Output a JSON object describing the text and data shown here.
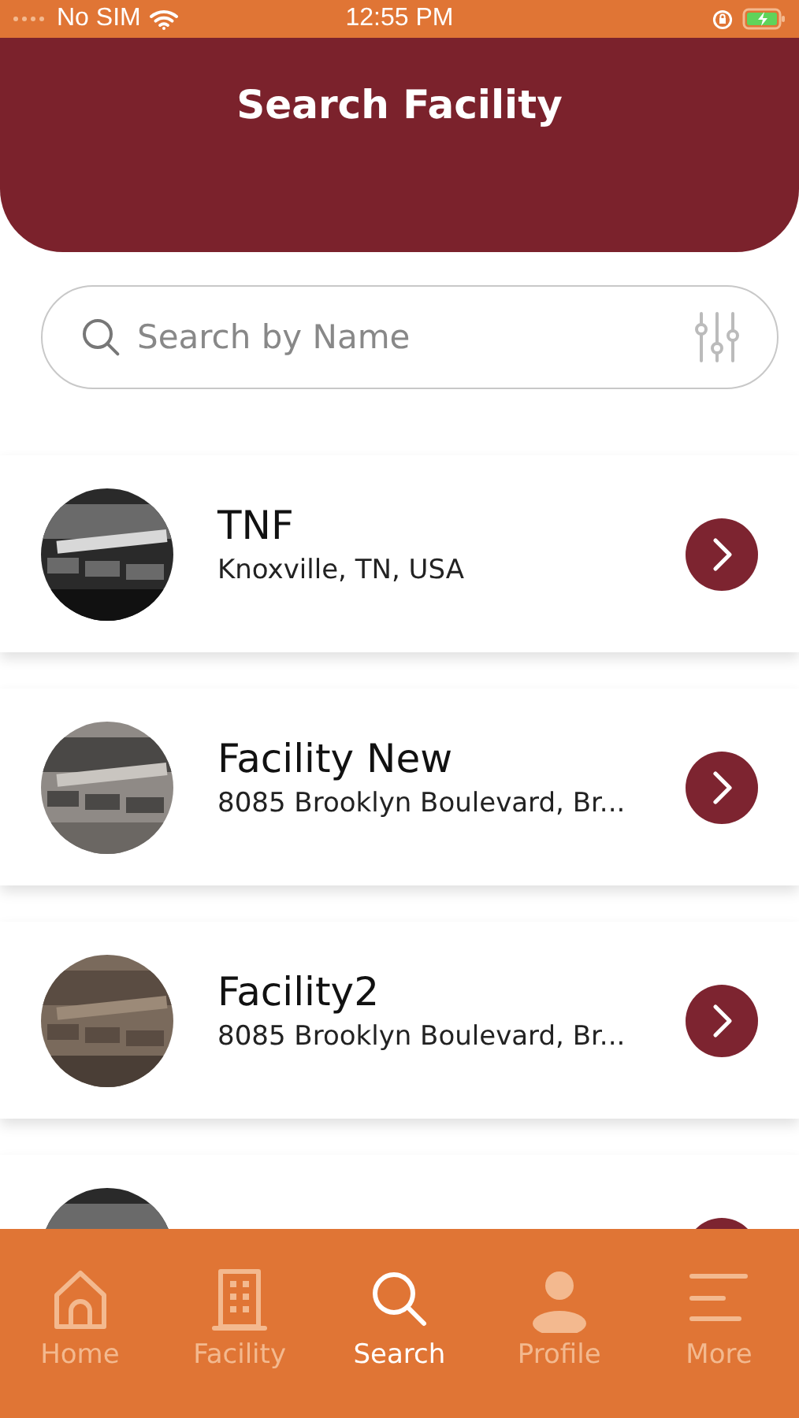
{
  "status_bar": {
    "carrier": "No SIM",
    "time": "12:55 PM"
  },
  "header": {
    "title": "Search Facility"
  },
  "search": {
    "placeholder": "Search by Name"
  },
  "facilities": [
    {
      "kind": "full",
      "name": "TNF",
      "address": "Knoxville, TN, USA"
    },
    {
      "kind": "full",
      "name": "Facility New",
      "address": "8085 Brooklyn Boulevard, Br..."
    },
    {
      "kind": "full",
      "name": "Facility2",
      "address": "8085 Brooklyn Boulevard, Br..."
    },
    {
      "kind": "covered"
    }
  ],
  "tabs": [
    {
      "label": "Home",
      "selected": false
    },
    {
      "label": "Facility",
      "selected": false
    },
    {
      "label": "Search",
      "selected": true
    },
    {
      "label": "Profile",
      "selected": false
    },
    {
      "label": "More",
      "selected": false
    }
  ]
}
